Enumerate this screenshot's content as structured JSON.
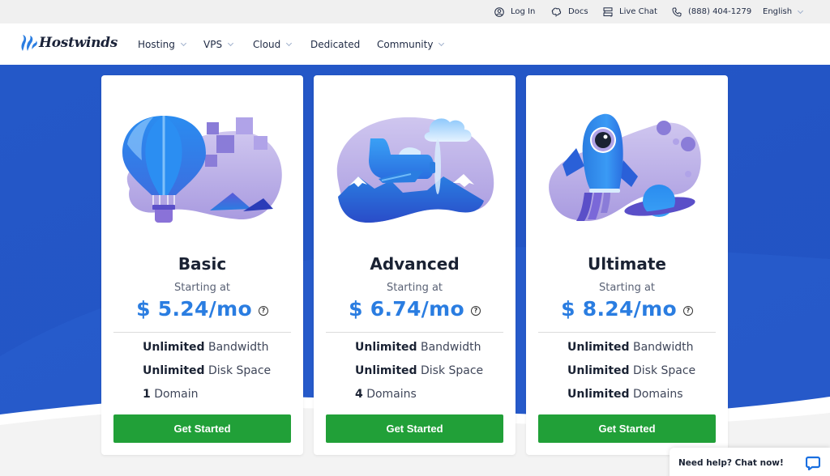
{
  "topbar": {
    "login": "Log In",
    "docs": "Docs",
    "live_chat": "Live Chat",
    "phone": "(888) 404-1279",
    "language": "English"
  },
  "nav": {
    "brand": "Hostwinds",
    "items": [
      {
        "label": "Hosting",
        "dropdown": true
      },
      {
        "label": "VPS",
        "dropdown": true
      },
      {
        "label": "Cloud",
        "dropdown": true
      },
      {
        "label": "Dedicated",
        "dropdown": false
      },
      {
        "label": "Community",
        "dropdown": true
      }
    ]
  },
  "plans": [
    {
      "name": "Basic",
      "starting_label": "Starting at",
      "price": "$ 5.24/mo",
      "illustration": "hot-air-balloon",
      "features": [
        {
          "bold": "Unlimited",
          "rest": " Bandwidth"
        },
        {
          "bold": "Unlimited",
          "rest": " Disk Space"
        },
        {
          "bold": "1",
          "rest": " Domain"
        }
      ],
      "cta": "Get Started"
    },
    {
      "name": "Advanced",
      "starting_label": "Starting at",
      "price": "$ 6.74/mo",
      "illustration": "airplane",
      "features": [
        {
          "bold": "Unlimited",
          "rest": " Bandwidth"
        },
        {
          "bold": "Unlimited",
          "rest": " Disk Space"
        },
        {
          "bold": "4",
          "rest": " Domains"
        }
      ],
      "cta": "Get Started"
    },
    {
      "name": "Ultimate",
      "starting_label": "Starting at",
      "price": "$ 8.24/mo",
      "illustration": "rocket",
      "features": [
        {
          "bold": "Unlimited",
          "rest": " Bandwidth"
        },
        {
          "bold": "Unlimited",
          "rest": " Disk Space"
        },
        {
          "bold": "Unlimited",
          "rest": " Domains"
        }
      ],
      "cta": "Get Started"
    }
  ],
  "help_icon": "?",
  "chat_widget": {
    "label": "Need help? Chat now!"
  },
  "colors": {
    "hero_blue": "#2356c6",
    "price_blue": "#2a7de1",
    "cta_green": "#21a038"
  }
}
